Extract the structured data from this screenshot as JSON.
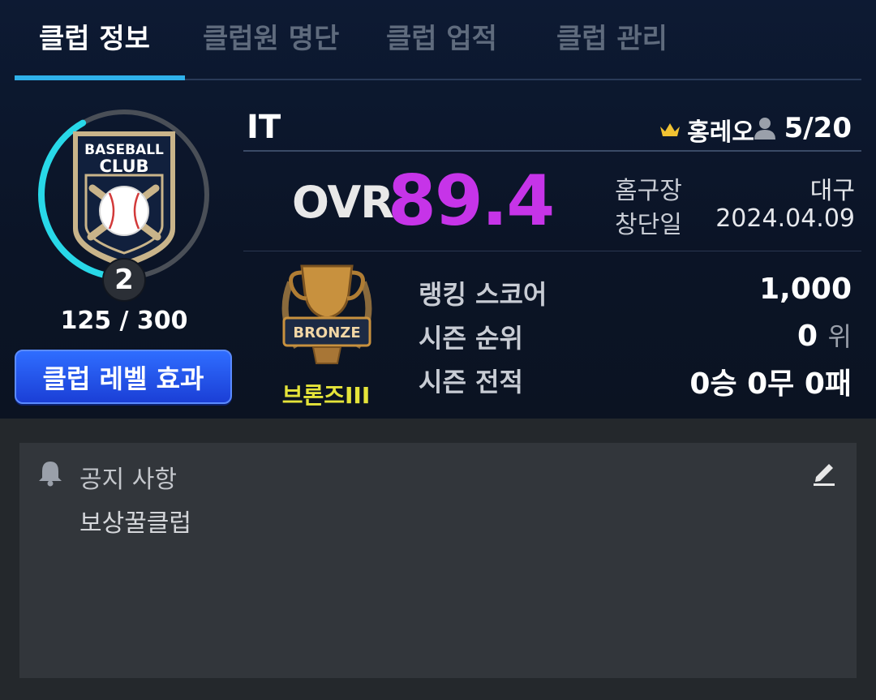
{
  "tabs": [
    {
      "label": "클럽 정보",
      "active": true
    },
    {
      "label": "클럽원 명단",
      "active": false
    },
    {
      "label": "클럽 업적",
      "active": false
    },
    {
      "label": "클럽 관리",
      "active": false
    }
  ],
  "emblem": {
    "line1": "BASEBALL",
    "line2": "CLUB",
    "level": "2",
    "exp_text": "125 / 300",
    "exp_progress": 0.4167
  },
  "level_button_label": "클럽 레벨 효과",
  "club": {
    "name": "IT",
    "master": "홍레오",
    "members": "5/20"
  },
  "ovr": {
    "label": "OVR",
    "value": "89.4"
  },
  "info": {
    "stadium_label": "홈구장",
    "stadium_value": "대구",
    "founded_label": "창단일",
    "founded_value": "2024.04.09"
  },
  "rank": {
    "trophy_text": "BRONZE",
    "tier": "브론즈III",
    "score_label": "랭킹 스코어",
    "score_value": "1,000",
    "season_rank_label": "시즌 순위",
    "season_rank_value": "0",
    "season_rank_unit": "위",
    "record_label": "시즌 전적",
    "record_value": "0승 0무 0패"
  },
  "notice": {
    "title": "공지 사항",
    "body": "보상꿀클럽"
  },
  "colors": {
    "accent_tab": "#2fb1ea",
    "ovr": "#c634e8",
    "tier": "#e5e43a",
    "button": "#2f6dff"
  },
  "icons": [
    "crown-icon",
    "person-icon",
    "bell-icon",
    "edit-icon"
  ]
}
